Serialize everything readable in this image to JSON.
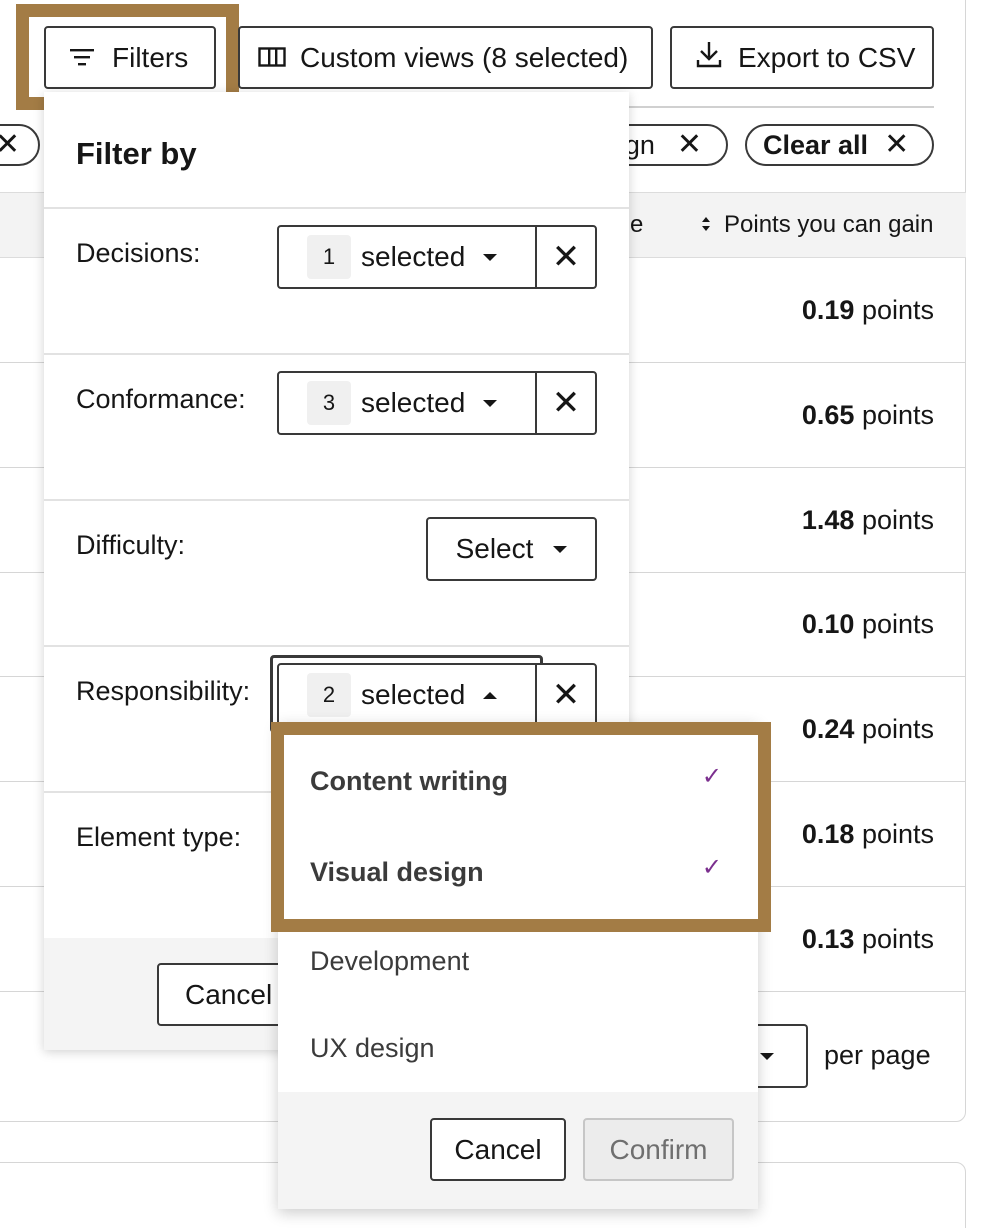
{
  "toolbar": {
    "filters_label": "Filters",
    "custom_views_label": "Custom views (8 selected)",
    "export_label": "Export to CSV"
  },
  "chips": {
    "partial_left": "",
    "partial_right": "ign",
    "clear_all": "Clear all"
  },
  "table": {
    "head_partial": "e",
    "points_header": "Points you can gain",
    "rows": [
      {
        "value": "0.19",
        "unit": "points"
      },
      {
        "value": "0.65",
        "unit": "points"
      },
      {
        "value": "1.48",
        "unit": "points"
      },
      {
        "value": "0.10",
        "unit": "points"
      },
      {
        "value": "0.24",
        "unit": "points"
      },
      {
        "value": "0.18",
        "unit": "points"
      },
      {
        "value": "0.13",
        "unit": "points"
      }
    ],
    "per_page": "per page"
  },
  "filter_panel": {
    "title": "Filter by",
    "decisions": {
      "label": "Decisions:",
      "count": "1",
      "text": "selected"
    },
    "conformance": {
      "label": "Conformance:",
      "count": "3",
      "text": "selected"
    },
    "difficulty": {
      "label": "Difficulty:",
      "text": "Select"
    },
    "responsibility": {
      "label": "Responsibility:",
      "count": "2",
      "text": "selected"
    },
    "element_type": {
      "label": "Element type:"
    },
    "cancel_label": "Cancel"
  },
  "dropdown": {
    "options": [
      {
        "label": "Content writing",
        "selected": true
      },
      {
        "label": "Visual design",
        "selected": true
      },
      {
        "label": "Development",
        "selected": false
      },
      {
        "label": "UX design",
        "selected": false
      }
    ],
    "cancel_label": "Cancel",
    "confirm_label": "Confirm"
  },
  "colors": {
    "highlight": "#a37c45",
    "check": "#7b2f8e"
  }
}
